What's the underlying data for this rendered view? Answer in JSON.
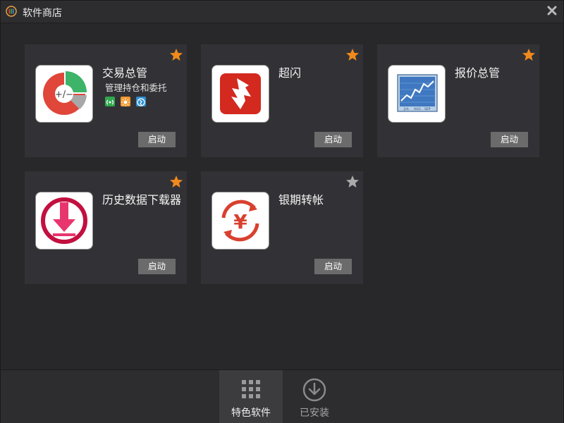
{
  "window": {
    "title": "软件商店"
  },
  "cards": [
    {
      "name": "交易总管",
      "desc": "管理持仓和委托",
      "launch_label": "启动",
      "star": "favorite",
      "icon": "pie-chart-icon"
    },
    {
      "name": "超闪",
      "launch_label": "启动",
      "star": "favorite",
      "icon": "flash-download-icon"
    },
    {
      "name": "报价总管",
      "launch_label": "启动",
      "star": "favorite",
      "icon": "stock-chart-icon"
    },
    {
      "name": "历史数据下载器",
      "launch_label": "启动",
      "star": "favorite",
      "icon": "download-circle-icon"
    },
    {
      "name": "银期转帐",
      "launch_label": "启动",
      "star": "not-favorite",
      "icon": "yen-transfer-icon"
    }
  ],
  "tabs": [
    {
      "label": "特色软件",
      "active": true,
      "icon": "grid-icon"
    },
    {
      "label": "已安装",
      "active": false,
      "icon": "download-circle-icon"
    }
  ],
  "colors": {
    "star_active": "#f08a1c",
    "star_inactive": "#aaaaaa",
    "accent_red": "#d9402f"
  }
}
